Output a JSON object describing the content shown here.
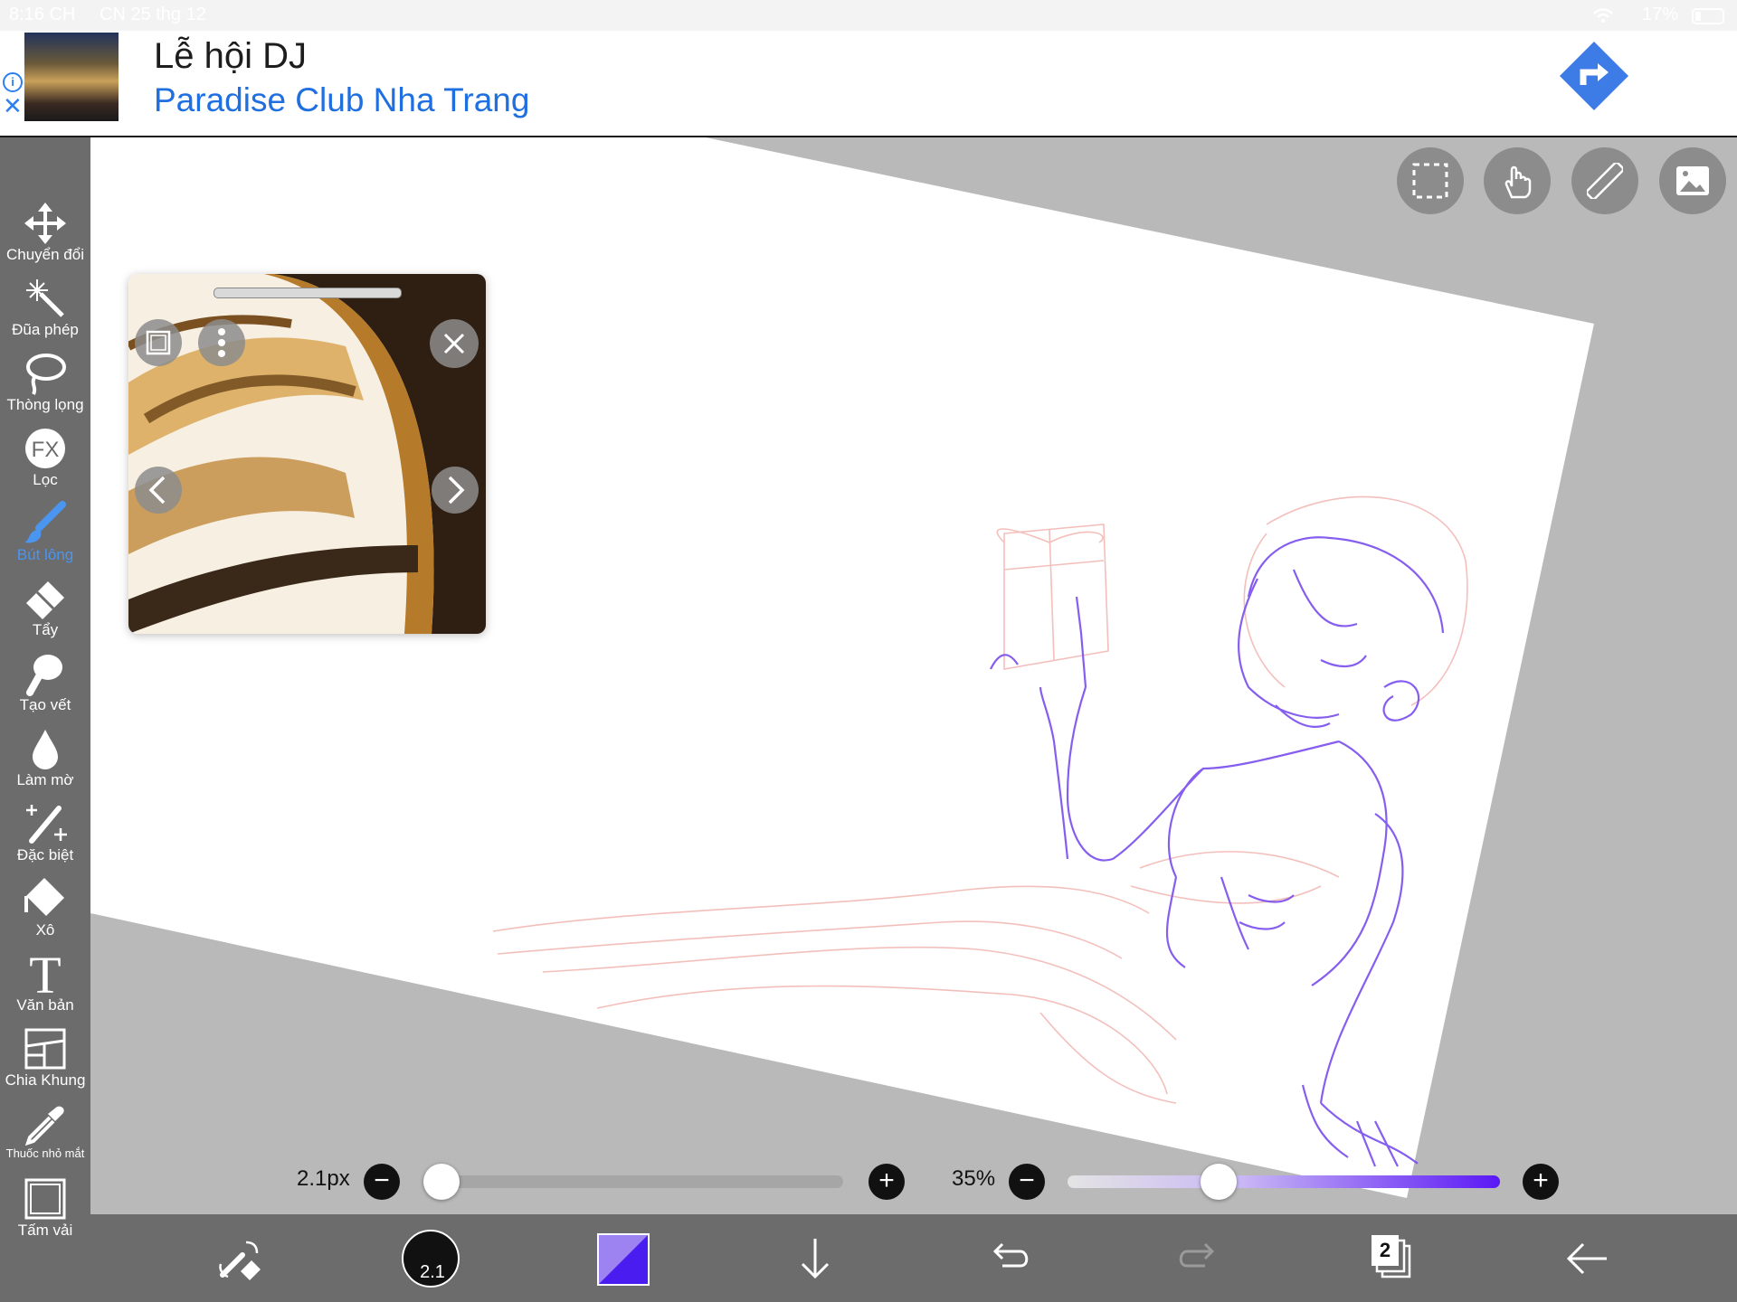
{
  "status_bar": {
    "time": "8:16 CH",
    "date": "CN 25 thg 12",
    "battery": "17%"
  },
  "ad": {
    "title": "Lễ hội DJ",
    "subtitle": "Paradise Club Nha Trang",
    "info_icon": "info-icon",
    "close_icon": "close-icon",
    "action_icon": "directions-icon",
    "accent": "#1f6fe0"
  },
  "toolbar": {
    "items": [
      {
        "label": "Chuyển đổi",
        "icon": "move-arrows-icon"
      },
      {
        "label": "Đũa phép",
        "icon": "magic-wand-icon"
      },
      {
        "label": "Thòng lọng",
        "icon": "lasso-icon"
      },
      {
        "label": "Lọc",
        "icon": "fx-icon"
      },
      {
        "label": "Bút lông",
        "icon": "brush-icon",
        "active": true
      },
      {
        "label": "Tẩy",
        "icon": "eraser-icon"
      },
      {
        "label": "Tạo vết",
        "icon": "smudge-icon"
      },
      {
        "label": "Làm mờ",
        "icon": "blur-drop-icon"
      },
      {
        "label": "Đặc biệt",
        "icon": "special-pen-icon"
      },
      {
        "label": "Xô",
        "icon": "bucket-icon"
      },
      {
        "label": "Văn bản",
        "icon": "text-icon"
      },
      {
        "label": "Chia Khung",
        "icon": "frame-divider-icon"
      },
      {
        "label": "Thuốc nhỏ mắt",
        "icon": "eyedropper-icon"
      },
      {
        "label": "Tấm vải",
        "icon": "canvas-icon"
      }
    ],
    "active_color": "#4a95f0"
  },
  "top_controls": [
    "selection-icon",
    "hand-gesture-icon",
    "ruler-icon",
    "image-reference-icon"
  ],
  "reference_window": {
    "icons": [
      "layer-icon",
      "more-icon",
      "close-icon",
      "prev-arrow-icon",
      "next-arrow-icon"
    ]
  },
  "brush_size": {
    "label": "2.1px",
    "level": 0.04
  },
  "opacity": {
    "label": "35%",
    "level": 0.35,
    "color": "#5a18f5"
  },
  "bottom_bar": {
    "brush_preview_label": "2.1",
    "layer_count": "2",
    "color": "#4a1cf0",
    "icons": [
      "swap-tools-icon",
      "brush-size-icon",
      "color-swatch-icon",
      "download-icon",
      "undo-icon",
      "redo-icon",
      "layers-icon",
      "back-arrow-icon"
    ]
  }
}
